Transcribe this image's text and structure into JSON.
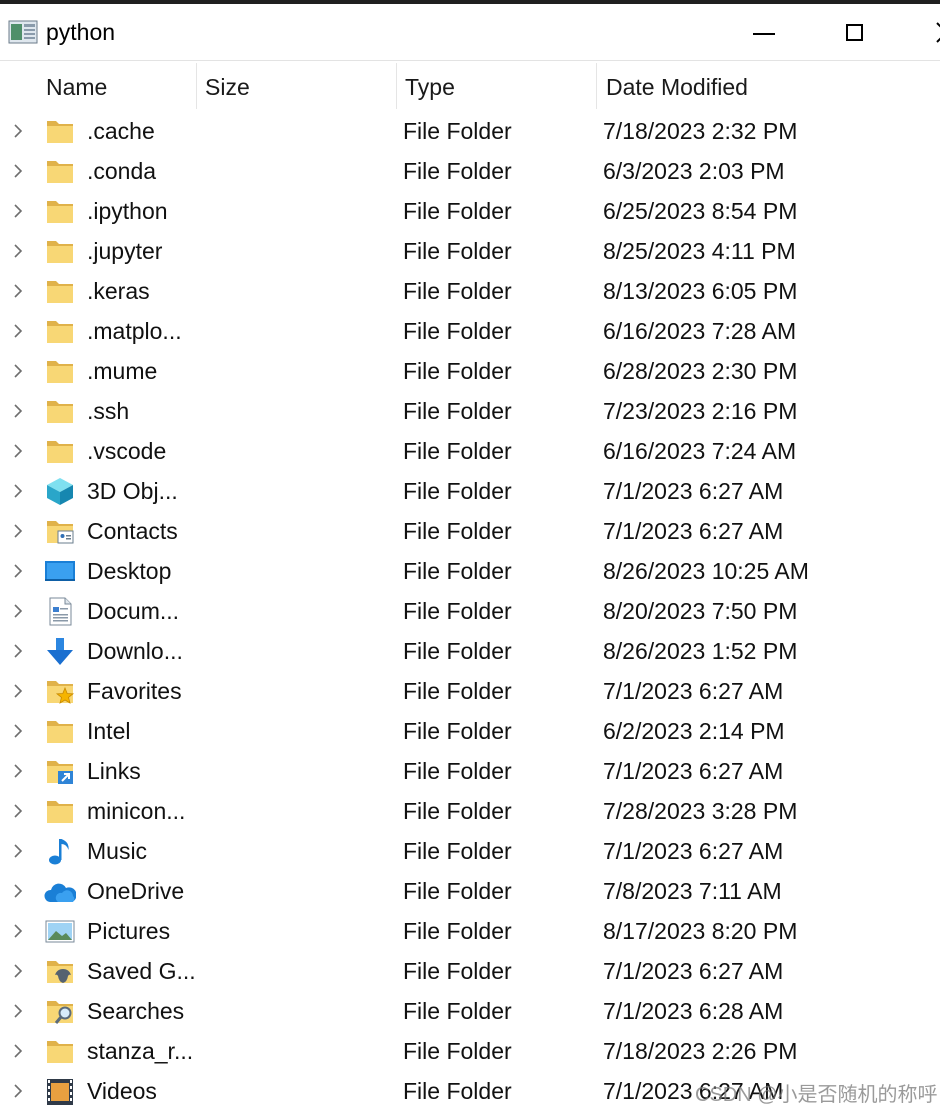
{
  "window": {
    "title": "python"
  },
  "columns": {
    "name": "Name",
    "size": "Size",
    "type": "Type",
    "date": "Date Modified"
  },
  "rows": [
    {
      "name": ".cache",
      "type": "File Folder",
      "date": "7/18/2023 2:32 PM",
      "icon": "folder-icon"
    },
    {
      "name": ".conda",
      "type": "File Folder",
      "date": "6/3/2023 2:03 PM",
      "icon": "folder-icon"
    },
    {
      "name": ".ipython",
      "type": "File Folder",
      "date": "6/25/2023 8:54 PM",
      "icon": "folder-icon"
    },
    {
      "name": ".jupyter",
      "type": "File Folder",
      "date": "8/25/2023 4:11 PM",
      "icon": "folder-icon"
    },
    {
      "name": ".keras",
      "type": "File Folder",
      "date": "8/13/2023 6:05 PM",
      "icon": "folder-icon"
    },
    {
      "name": ".matplo...",
      "type": "File Folder",
      "date": "6/16/2023 7:28 AM",
      "icon": "folder-icon"
    },
    {
      "name": ".mume",
      "type": "File Folder",
      "date": "6/28/2023 2:30 PM",
      "icon": "folder-icon"
    },
    {
      "name": ".ssh",
      "type": "File Folder",
      "date": "7/23/2023 2:16 PM",
      "icon": "folder-icon"
    },
    {
      "name": ".vscode",
      "type": "File Folder",
      "date": "6/16/2023 7:24 AM",
      "icon": "folder-icon"
    },
    {
      "name": "3D Obj...",
      "type": "File Folder",
      "date": "7/1/2023 6:27 AM",
      "icon": "3d-objects-icon"
    },
    {
      "name": "Contacts",
      "type": "File Folder",
      "date": "7/1/2023 6:27 AM",
      "icon": "contacts-icon"
    },
    {
      "name": "Desktop",
      "type": "File Folder",
      "date": "8/26/2023 10:25 AM",
      "icon": "desktop-icon"
    },
    {
      "name": "Docum...",
      "type": "File Folder",
      "date": "8/20/2023 7:50 PM",
      "icon": "documents-icon"
    },
    {
      "name": "Downlo...",
      "type": "File Folder",
      "date": "8/26/2023 1:52 PM",
      "icon": "downloads-icon"
    },
    {
      "name": "Favorites",
      "type": "File Folder",
      "date": "7/1/2023 6:27 AM",
      "icon": "favorites-icon"
    },
    {
      "name": "Intel",
      "type": "File Folder",
      "date": "6/2/2023 2:14 PM",
      "icon": "folder-icon"
    },
    {
      "name": "Links",
      "type": "File Folder",
      "date": "7/1/2023 6:27 AM",
      "icon": "links-icon"
    },
    {
      "name": "minicon...",
      "type": "File Folder",
      "date": "7/28/2023 3:28 PM",
      "icon": "folder-icon"
    },
    {
      "name": "Music",
      "type": "File Folder",
      "date": "7/1/2023 6:27 AM",
      "icon": "music-icon"
    },
    {
      "name": "OneDrive",
      "type": "File Folder",
      "date": "7/8/2023 7:11 AM",
      "icon": "onedrive-icon"
    },
    {
      "name": "Pictures",
      "type": "File Folder",
      "date": "8/17/2023 8:20 PM",
      "icon": "pictures-icon"
    },
    {
      "name": "Saved G...",
      "type": "File Folder",
      "date": "7/1/2023 6:27 AM",
      "icon": "saved-games-icon"
    },
    {
      "name": "Searches",
      "type": "File Folder",
      "date": "7/1/2023 6:28 AM",
      "icon": "searches-icon"
    },
    {
      "name": "stanza_r...",
      "type": "File Folder",
      "date": "7/18/2023 2:26 PM",
      "icon": "folder-icon"
    },
    {
      "name": "Videos",
      "type": "File Folder",
      "date": "7/1/2023 6:27 AM",
      "icon": "videos-icon"
    }
  ],
  "watermark": "CSDN @小是否随机的称呼",
  "colors": {
    "folder": "#f8d775",
    "folder_dark": "#e0b24a",
    "accent_blue": "#1a7fd6"
  }
}
